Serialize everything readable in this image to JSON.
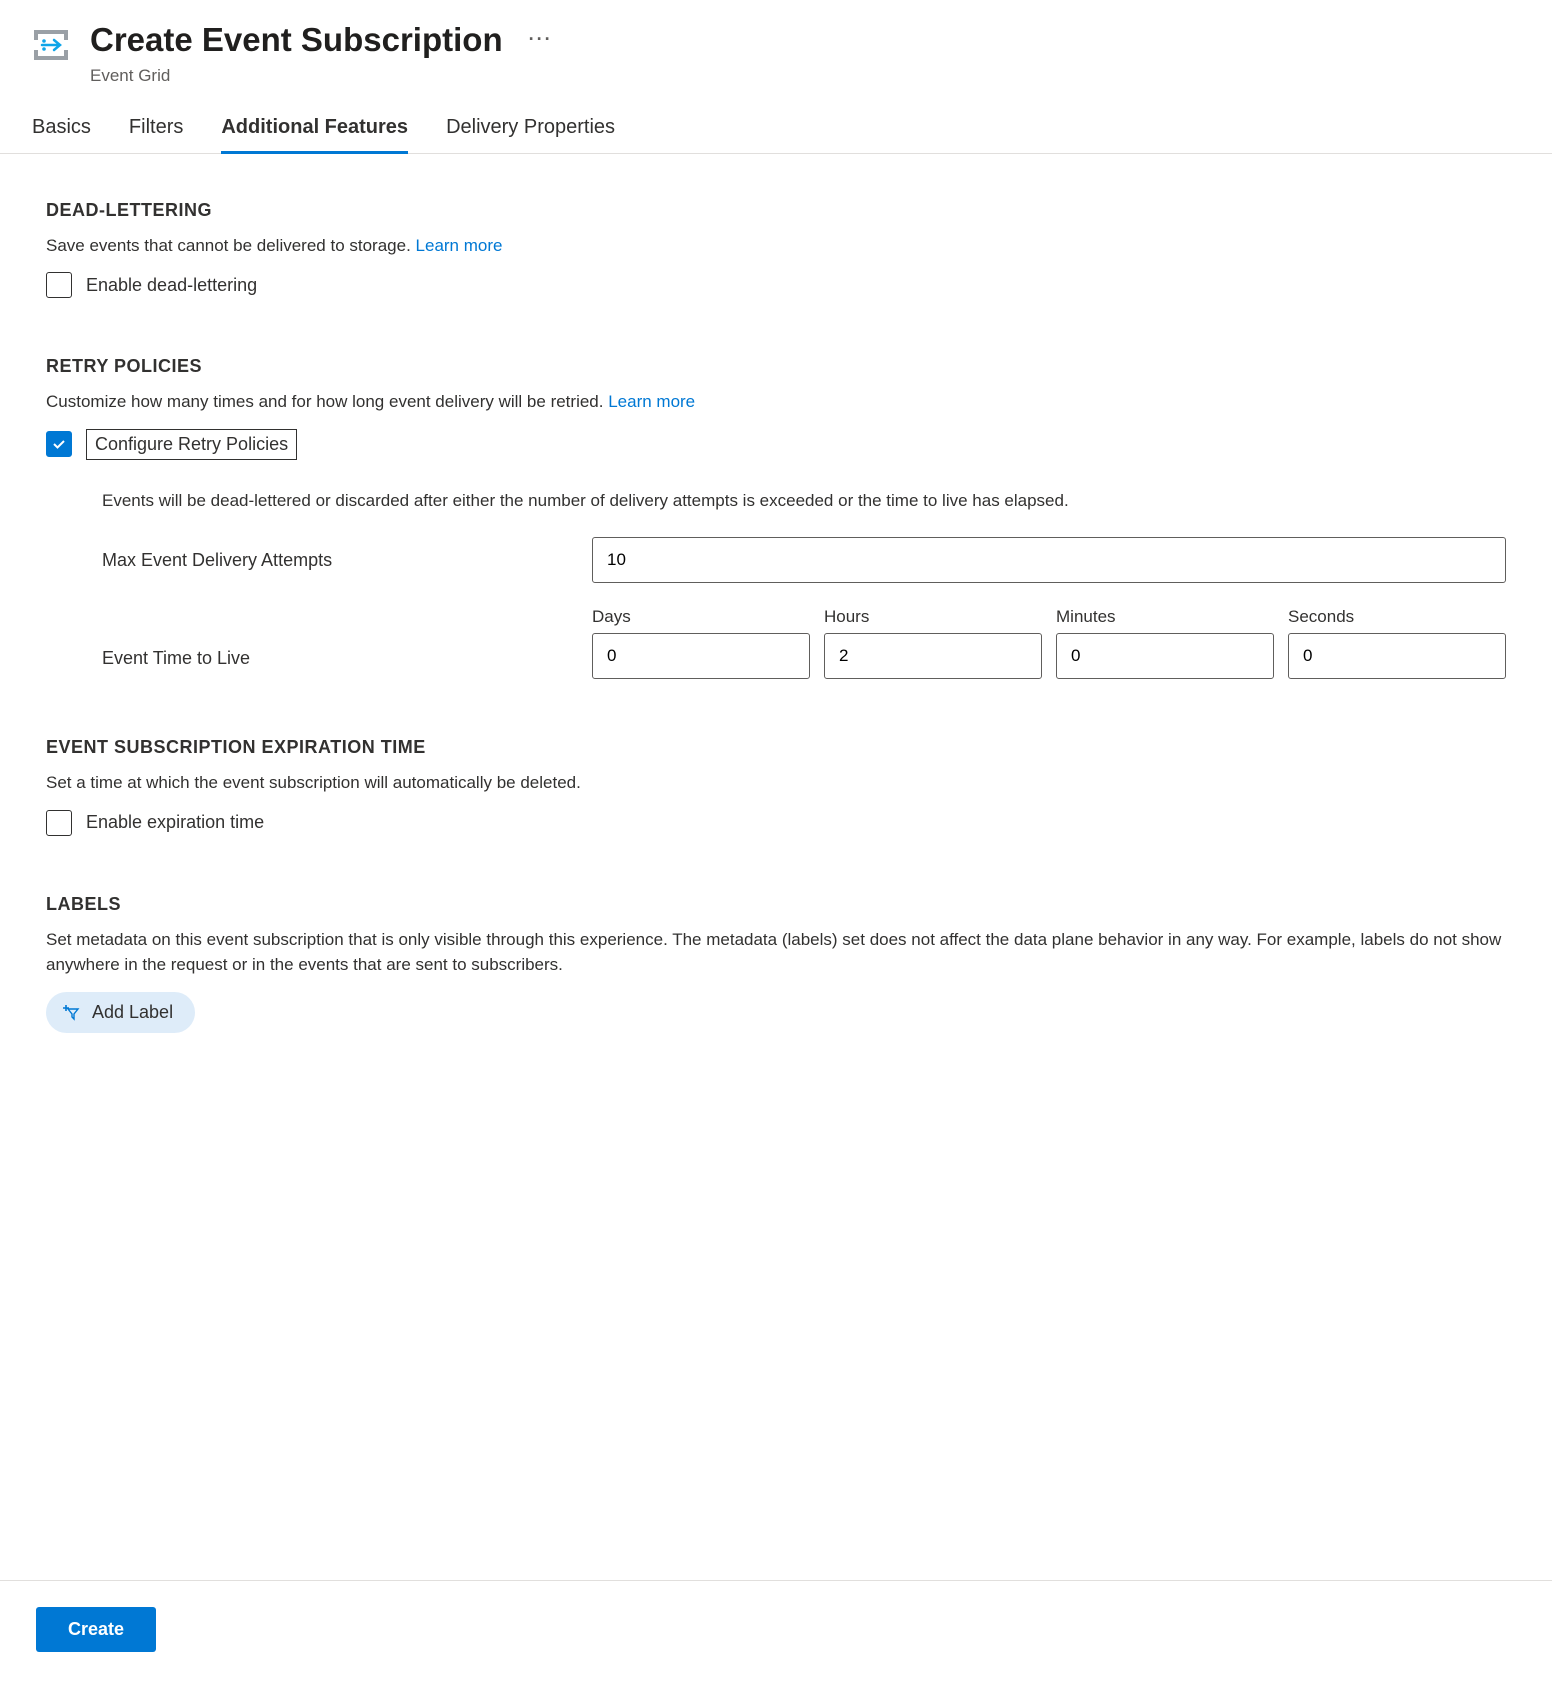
{
  "header": {
    "title": "Create Event Subscription",
    "subtitle": "Event Grid"
  },
  "tabs": [
    {
      "label": "Basics",
      "active": false
    },
    {
      "label": "Filters",
      "active": false
    },
    {
      "label": "Additional Features",
      "active": true
    },
    {
      "label": "Delivery Properties",
      "active": false
    }
  ],
  "deadLettering": {
    "title": "DEAD-LETTERING",
    "desc": "Save events that cannot be delivered to storage. ",
    "learnMore": "Learn more",
    "checkboxLabel": "Enable dead-lettering",
    "checked": false
  },
  "retryPolicies": {
    "title": "RETRY POLICIES",
    "desc": "Customize how many times and for how long event delivery will be retried. ",
    "learnMore": "Learn more",
    "checkboxLabel": "Configure Retry Policies",
    "checked": true,
    "info": "Events will be dead-lettered or discarded after either the number of delivery attempts is exceeded or the time to live has elapsed.",
    "maxAttemptsLabel": "Max Event Delivery Attempts",
    "maxAttemptsValue": "10",
    "ttlLabel": "Event Time to Live",
    "ttl": {
      "daysLabel": "Days",
      "daysValue": "0",
      "hoursLabel": "Hours",
      "hoursValue": "2",
      "minutesLabel": "Minutes",
      "minutesValue": "0",
      "secondsLabel": "Seconds",
      "secondsValue": "0"
    }
  },
  "expiration": {
    "title": "EVENT SUBSCRIPTION EXPIRATION TIME",
    "desc": "Set a time at which the event subscription will automatically be deleted.",
    "checkboxLabel": "Enable expiration time",
    "checked": false
  },
  "labels": {
    "title": "LABELS",
    "desc": "Set metadata on this event subscription that is only visible through this experience. The metadata (labels) set does not affect the data plane behavior in any way. For example, labels do not show anywhere in the request or in the events that are sent to subscribers.",
    "addButton": "Add Label"
  },
  "footer": {
    "createButton": "Create"
  }
}
